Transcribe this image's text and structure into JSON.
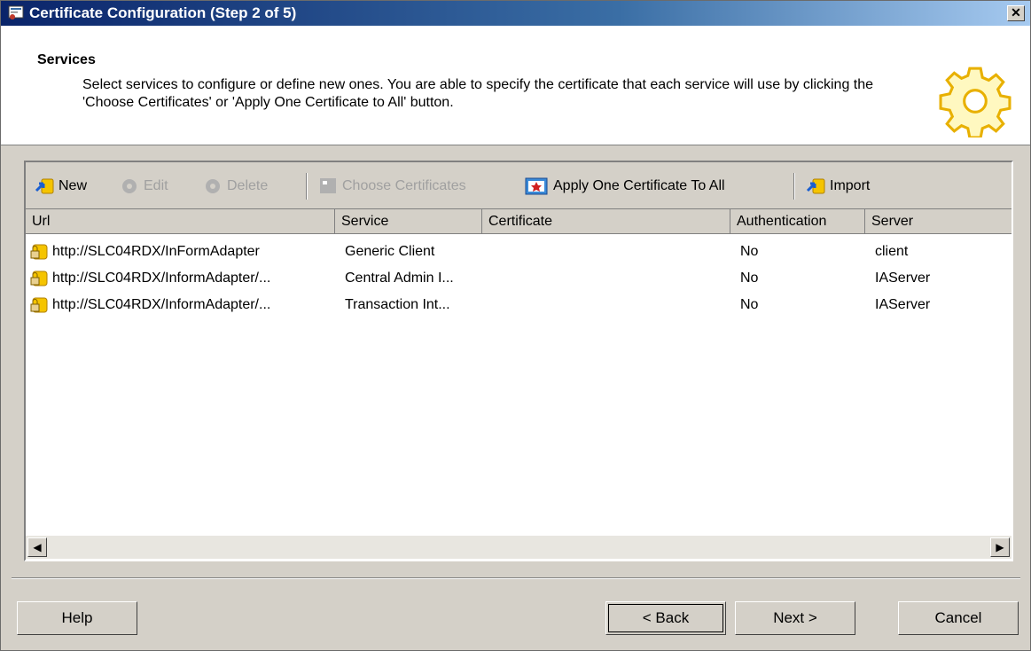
{
  "window": {
    "title": "Certificate Configuration (Step 2 of 5)",
    "close_label": "✕"
  },
  "header": {
    "title": "Services",
    "description": "Select services to configure or define new ones.  You are able to specify the certificate that each service will use by clicking the 'Choose Certificates' or 'Apply One Certificate to All' button."
  },
  "toolbar": {
    "new_label": "New",
    "edit_label": "Edit",
    "delete_label": "Delete",
    "choose_label": "Choose Certificates",
    "apply_label": "Apply One Certificate To All",
    "import_label": "Import"
  },
  "table": {
    "columns": [
      "Url",
      "Service",
      "Certificate",
      "Authentication",
      "Server"
    ],
    "rows": [
      {
        "url": "http://SLC04RDX/InFormAdapter",
        "service": "Generic Client",
        "certificate": "",
        "authentication": "No",
        "server": "client"
      },
      {
        "url": "http://SLC04RDX/InformAdapter/...",
        "service": "Central Admin I...",
        "certificate": "",
        "authentication": "No",
        "server": "IAServer"
      },
      {
        "url": "http://SLC04RDX/InformAdapter/...",
        "service": "Transaction Int...",
        "certificate": "",
        "authentication": "No",
        "server": "IAServer"
      }
    ]
  },
  "buttons": {
    "help": "Help",
    "back": "< Back",
    "next": "Next >",
    "cancel": "Cancel"
  },
  "scroll": {
    "left": "◀",
    "right": "▶"
  }
}
